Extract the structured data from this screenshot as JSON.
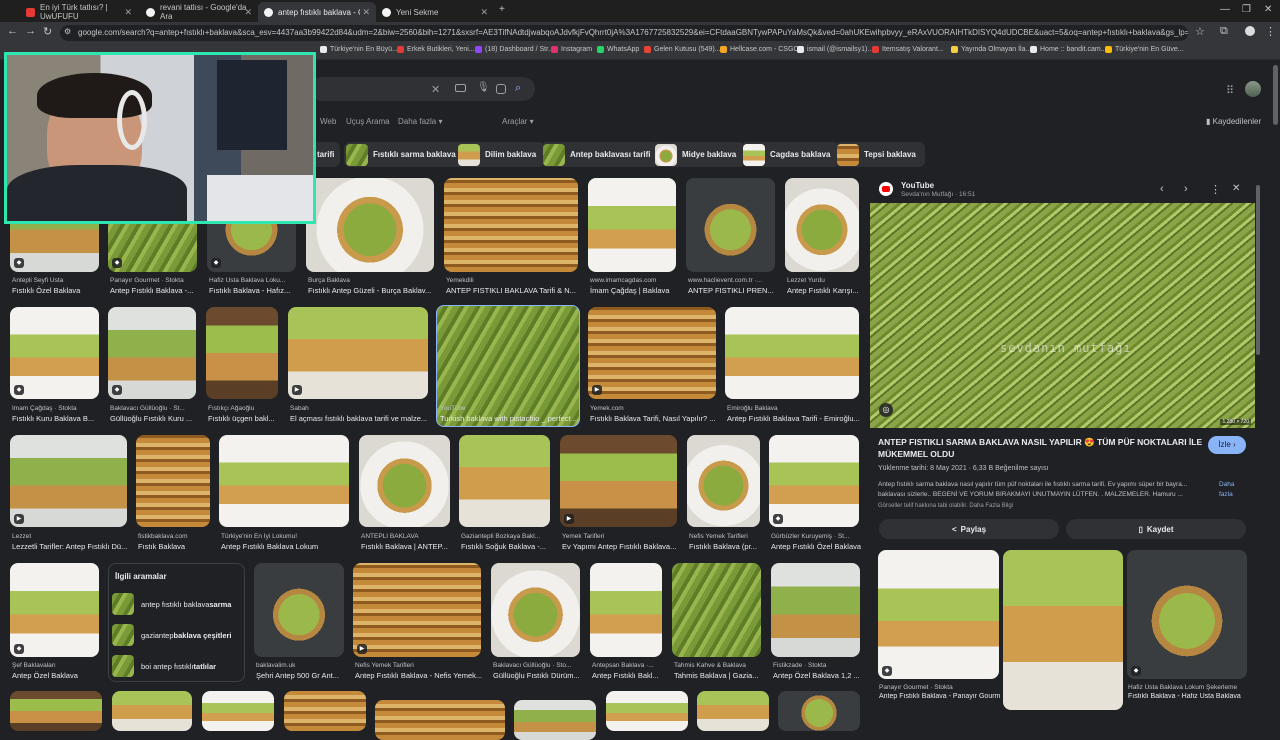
{
  "tabs": [
    {
      "label": "En iyi Türk tatlısı? | UwUFUFU",
      "fav_color": "#e53935"
    },
    {
      "label": "revani tatlısı - Google'da Ara",
      "fav_color": "#f1f3f4"
    },
    {
      "label": "antep fıstıklı baklava - Google'da Ara",
      "fav_color": "#f1f3f4"
    },
    {
      "label": "Yeni Sekme",
      "fav_color": "#f1f3f4"
    }
  ],
  "address_bar": {
    "url": "google.com/search?q=antep+fıstıklı+baklava&sca_esv=4437aa3b99422d84&udm=2&biw=2560&bih=1271&sxsrf=AE3TifNAdtdjwabqoAJdvfkjFvQhrrt0jA%3A1767725832529&ei=CFtdaaGBNTywPAPuYaMsQk&ved=0ahUKEwihpbvyy_eRAxVUORAIHTkDISYQ4dUDCBE&uact=5&oq=antep+fıstıklı+baklava&gs_lp=Egtnd3Mtd2l6LWltZyIZYW50ZXAgZsSxc3TEsWtsxLEgYmFrbGF2YTIL"
  },
  "bookmarks": [
    {
      "label": "Türkiye'nin En Büyü...",
      "color": "#e8eaed"
    },
    {
      "label": "Erkek Butikleri, Yeni...",
      "color": "#e53935"
    },
    {
      "label": "(18) Dashboard / Str...",
      "color": "#9146ff"
    },
    {
      "label": "Instagram",
      "color": "#e1306c"
    },
    {
      "label": "WhatsApp",
      "color": "#25d366"
    },
    {
      "label": "Gelen Kutusu (549)...",
      "color": "#ea4335"
    },
    {
      "label": "Hellcase.com - CSGO...",
      "color": "#f5a623"
    },
    {
      "label": "ismail (@ismailsy1)...",
      "color": "#e8eaed"
    },
    {
      "label": "Itemsatış Valorant...",
      "color": "#e53935"
    },
    {
      "label": "Yayında Olmayan İla...",
      "color": "#f4d03f"
    },
    {
      "label": "Home :: bandit.cam...",
      "color": "#e8eaed"
    },
    {
      "label": "Türkiye'nin En Güve...",
      "color": "#fbbc05"
    }
  ],
  "search_nav": {
    "web": "Web",
    "ucus": "Uçuş Arama",
    "daha": "Daha fazla ▾",
    "araclar": "Araçlar ▾",
    "kaydedilenler": "Kaydedilenler"
  },
  "chips": [
    "tarifi",
    "Fıstıklı sarma baklava",
    "Dilim baklava",
    "Antep baklavası tarifi",
    "Midye baklava",
    "Cagdas baklava",
    "Tepsi baklava"
  ],
  "rows": [
    [
      {
        "src": "Antepli Seyfi Usta",
        "title": "Fıstıklı Özel Baklava"
      },
      {
        "src": "Panayır Gourmet · Stokta",
        "title": "Antep Fıstıklı Baklava -..."
      },
      {
        "src": "Hafiz Usta Baklava Loku...",
        "title": "Fıstıklı Baklava - Hafız..."
      },
      {
        "src": "Burça Baklava",
        "title": "Fıstıklı Antep Güzeli - Burça Baklav..."
      },
      {
        "src": "Yemekdili",
        "title": "ANTEP FISTIKLI BAKLAVA Tarifi & N..."
      },
      {
        "src": "www.imamcagdas.com",
        "title": "İmam Çağdaş | Baklava"
      },
      {
        "src": "www.haclievent.com.tr ·...",
        "title": "ANTEP FISTIKLI PREN..."
      },
      {
        "src": "Lezzet Yurdu",
        "title": "Antep Fıstıklı Karışı..."
      }
    ],
    [
      {
        "src": "İmam Çağdaş · Stokta",
        "title": "Fıstıklı Kuru Baklava B..."
      },
      {
        "src": "Baklavacı Güllüoğlu · St...",
        "title": "Güllüoğlu Fıstıklı Kuru ..."
      },
      {
        "src": "Fıstıkçı Ağaoğlu",
        "title": "Fıstıklı üçgen bakl..."
      },
      {
        "src": "Sabah",
        "title": "El açması fıstıklı baklava tarifi ve malze..."
      },
      {
        "src": "YouTube",
        "title": "Turkish baklava with pistachio _ perfect ..."
      },
      {
        "src": "Yemek.com",
        "title": "Fıstıklı Baklava Tarifi, Nasıl Yapılır? ..."
      },
      {
        "src": "Emiroğlu Baklava",
        "title": "Antep Fıstıklı Baklava Tarifi - Emiroğlu..."
      }
    ],
    [
      {
        "src": "Lezzet",
        "title": "Lezzetli Tarifler: Antep Fıstıklı Dü..."
      },
      {
        "src": "fistikbaklava.com",
        "title": "Fıstık Baklava"
      },
      {
        "src": "Türkiye'nin En İyi Lokumu!",
        "title": "Antep Fıstıklı Baklava Lokum"
      },
      {
        "src": "ANTEPLI BAKLAVA",
        "title": "Fıstıklı Baklava | ANTEP..."
      },
      {
        "src": "Gaziantepli Bozkaya Bakl...",
        "title": "Fıstıklı Soğuk Baklava -..."
      },
      {
        "src": "Yemek Tarifleri",
        "title": "Ev Yapımı Antep Fıstıklı Baklava..."
      },
      {
        "src": "Nefis Yemek Tarifleri",
        "title": "Fıstıklı Baklava (pr..."
      },
      {
        "src": "Gürbüzler Kuruyemiş · St...",
        "title": "Antep Fıstıklı Özel Baklava..."
      }
    ],
    [
      {
        "src": "Şef Baklavaları",
        "title": "Antep Özel Baklava"
      },
      {
        "src": "baklavalim.uk",
        "title": "Şehri Antep 500 Gr Ant..."
      },
      {
        "src": "Nefis Yemek Tarifleri",
        "title": "Antep Fıstıklı Baklava - Nefis Yemek..."
      },
      {
        "src": "Baklavacı Güllüoğlu · Sto...",
        "title": "Güllüoğlu Fıstıklı Dürüm..."
      },
      {
        "src": "Antepsan Baklava ·...",
        "title": "Antep Fıstıklı Bakl..."
      },
      {
        "src": "Tahmis Kahve & Baklava",
        "title": "Tahmis Baklava | Gazia..."
      },
      {
        "src": "Fistikzade · Stokta",
        "title": "Antep Özel Baklava 1,2 ..."
      }
    ]
  ],
  "related": {
    "title": "İlgili aramalar",
    "items": [
      {
        "pre": "antep fıstıklı baklava",
        "bold": " sarma"
      },
      {
        "pre": "gaziantep",
        "bold": " baklava çeşitleri"
      },
      {
        "pre": "boi antep fıstıklı",
        "bold": " tatlılar"
      }
    ]
  },
  "panel": {
    "source": "YouTube",
    "channel": "Sevda'nın Mutfağı · 16:51",
    "watermark": "sevdanın mutfağı",
    "dims": "1.280 × 720",
    "title": "ANTEP FISTIKLI SARMA BAKLAVA NASIL YAPILIR 😍 TÜM PÜF NOKTALARI İLE MÜKEMMEL OLDU",
    "watch": "İzle ›",
    "meta": "Yüklenme tarihi: 8 May 2021 · 6,33 B Beğenilme sayısı",
    "desc": "Antep fıstıklı sarma baklava nasıl yapılır tüm püf noktaları ile fıstıklı sarma tarifi. Ev yapımı süper bir bayra... baklavası sizlerle.. BEGENİ VE YORUM BIRAKMAYI UNUTMAYIN LÜTFEN. . MALZEMELER. Hamuru ...",
    "more": "Daha fazla",
    "rights": "Görseller telif hakkına tabi olabilir. Daha Fazla Bilgi",
    "share": "Paylaş",
    "save": "Kaydet",
    "more_images": [
      {
        "src": "Panayır Gourmet · Stokta",
        "title": "Antep Fıstıklı Baklava - Panayır Gourme..."
      },
      {
        "src": "",
        "title": ""
      },
      {
        "src": "Hafiz Usta Baklava Lokum Şekerleme",
        "title": "Fıstıklı Baklava - Hafiz Usta Baklava"
      }
    ]
  }
}
